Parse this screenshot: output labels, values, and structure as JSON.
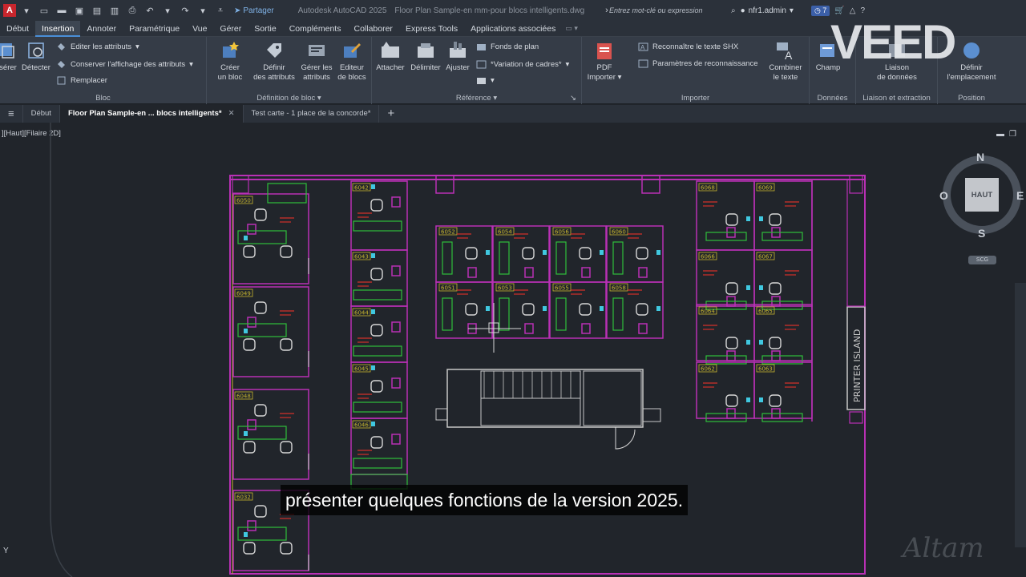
{
  "titlebar": {
    "app_logo": "A",
    "share_label": "Partager",
    "app_title": "Autodesk AutoCAD 2025",
    "file_title": "Floor Plan Sample-en mm-pour blocs intelligents.dwg",
    "search_placeholder": "Entrez mot-clé ou expression",
    "user": "nfr1.admin",
    "notification_count": "7"
  },
  "menu": {
    "items": [
      "Début",
      "Insertion",
      "Annoter",
      "Paramétrique",
      "Vue",
      "Gérer",
      "Sortie",
      "Compléments",
      "Collaborer",
      "Express Tools",
      "Applications associées"
    ],
    "active_index": 1
  },
  "ribbon": {
    "bloc": {
      "title": "Bloc",
      "inserer": "sérer",
      "detecter": "Détecter",
      "editer_attributs": "Editer les attributs",
      "conserver": "Conserver l'affichage des attributs",
      "remplacer": "Remplacer"
    },
    "definition": {
      "title": "Définition de bloc",
      "creer": [
        "Créer",
        "un bloc"
      ],
      "definir": [
        "Définir",
        "des attributs"
      ],
      "gerer": [
        "Gérer les",
        "attributs"
      ],
      "editeur": [
        "Editeur",
        "de blocs"
      ]
    },
    "reference": {
      "title": "Référence",
      "attacher": "Attacher",
      "delimiter": "Délimiter",
      "ajuster": "Ajuster",
      "fonds": "Fonds de plan",
      "variation": "*Variation de cadres*"
    },
    "importer": {
      "title": "Importer",
      "pdf": [
        "PDF",
        "Importer"
      ],
      "reconnaitre": "Reconnaître le texte SHX",
      "parametres": "Paramètres de reconnaissance",
      "combiner": [
        "Combiner",
        "le texte"
      ]
    },
    "donnees": {
      "title": "Données",
      "champ": "Champ"
    },
    "liaison": {
      "title": "Liaison et extraction",
      "label": [
        "Liaison",
        "de données"
      ]
    },
    "position": {
      "title": "Position",
      "label": [
        "Définir",
        "l'emplacement"
      ]
    }
  },
  "doc_tabs": {
    "debut": "Début",
    "active": "Floor Plan Sample-en ... blocs intelligents*",
    "other": "Test carte - 1 place de la concorde*"
  },
  "viewport": {
    "label": "][Haut][Filaire 2D]",
    "viewcube": {
      "n": "N",
      "s": "S",
      "e": "E",
      "w": "O",
      "face": "HAUT",
      "wcs": "SCG"
    },
    "ucs_y": "Y"
  },
  "floorplan": {
    "room_numbers": [
      "6050",
      "6049",
      "6048",
      "6032",
      "6042",
      "6043",
      "6044",
      "6045",
      "6046",
      "6052",
      "6054",
      "6056",
      "6060",
      "6051",
      "6053",
      "6055",
      "6058",
      "6068",
      "6069",
      "6066",
      "6067",
      "6064",
      "6065",
      "6062",
      "6063"
    ],
    "printer_island": "PRINTER ISLAND",
    "colors": {
      "wall": "#b930b5",
      "furniture": "#2fbf3a",
      "tag": "#c7b62f",
      "label": "#d2302a",
      "chair": "#d8d8d8",
      "monitor": "#40c8e0",
      "outline": "#c8c8c8"
    }
  },
  "overlay": {
    "watermark": "VEED",
    "subtitle": "présenter quelques fonctions de la version 2025.",
    "altam": "Altam"
  }
}
